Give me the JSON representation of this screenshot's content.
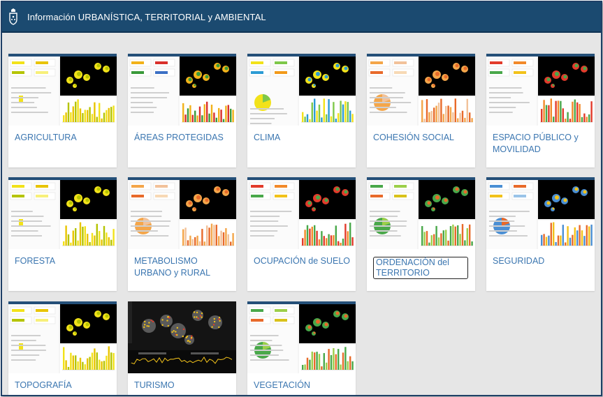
{
  "header": {
    "title": "Información URBANÍSTICA, TERRITORIAL y AMBIENTAL",
    "logo_icon": "coat-of-arms-icon"
  },
  "colors": {
    "header_bg": "#1b4a70",
    "label": "#3b76b0",
    "map_bg": "#000000"
  },
  "cards": [
    {
      "label": "AGRICULTURA",
      "theme": "yellow"
    },
    {
      "label": "ÁREAS PROTEGIDAS",
      "theme": "multi"
    },
    {
      "label": "CLIMA",
      "theme": "climate"
    },
    {
      "label": "COHESIÓN SOCIAL",
      "theme": "orange"
    },
    {
      "label": "ESPACIO PÚBLICO y MOVILIDAD",
      "theme": "red"
    },
    {
      "label": "FORESTA",
      "theme": "yellow"
    },
    {
      "label": "METABOLISMO URBANO y RURAL",
      "theme": "orange"
    },
    {
      "label": "OCUPACIÓN de SUELO",
      "theme": "red"
    },
    {
      "label": "ORDENACIÓN del TERRITORIO",
      "theme": "green",
      "focused": true
    },
    {
      "label": "SEGURIDAD",
      "theme": "blue"
    },
    {
      "label": "TOPOGRAFÍA",
      "theme": "yellow"
    },
    {
      "label": "TURISMO",
      "theme": "dark"
    },
    {
      "label": "VEGETACIÓN",
      "theme": "green"
    }
  ]
}
